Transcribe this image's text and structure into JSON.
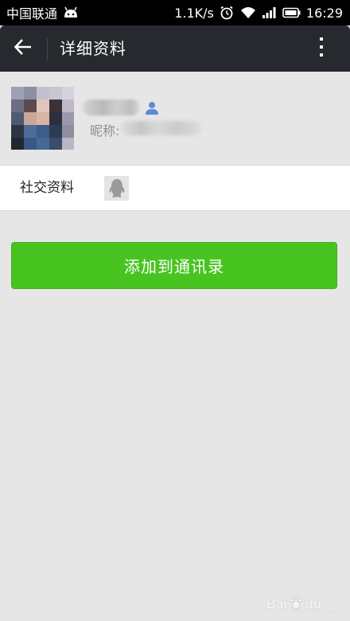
{
  "status_bar": {
    "carrier": "中国联通",
    "network_speed": "1.1K/s",
    "time": "16:29",
    "icons": [
      "android-icon",
      "alarm-icon",
      "wifi-icon",
      "signal-icon",
      "battery-icon"
    ]
  },
  "title_bar": {
    "title": "详细资料",
    "back_icon": "arrow-left-icon",
    "more_icon": "more-vertical-icon"
  },
  "profile": {
    "nickname_label": "昵称:",
    "badge_icon": "contact-person-icon",
    "badge_color": "#5b8bd4"
  },
  "social": {
    "label": "社交资料",
    "icon": "qq-penguin-icon"
  },
  "actions": {
    "add_label": "添加到通讯录",
    "add_color": "#48c421"
  },
  "watermark": {
    "text": "Bai",
    "paw": "du",
    "sub": "经验",
    "url": "jingyan.baidu.com"
  }
}
